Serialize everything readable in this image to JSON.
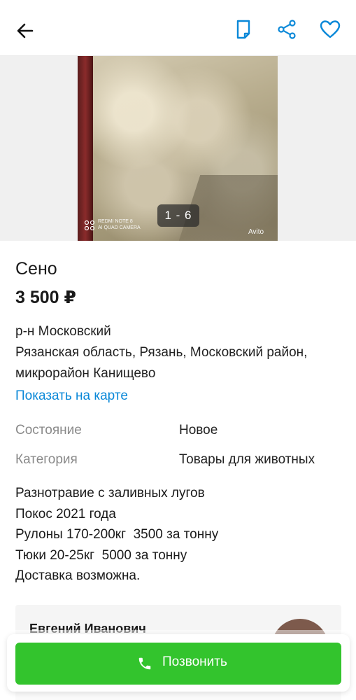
{
  "topbar": {
    "back_icon": "arrow-left-icon",
    "note_icon": "note-icon",
    "share_icon": "share-icon",
    "favorite_icon": "heart-icon",
    "accent_color": "#0a88d8"
  },
  "gallery": {
    "counter": "1 - 6",
    "watermark_line1": "REDMI NOTE 8",
    "watermark_line2": "AI QUAD CAMERA",
    "brand_watermark": "Avito"
  },
  "listing": {
    "title": "Сено",
    "price": "3 500 ₽",
    "address_line1": "р-н Московский",
    "address_line2": "Рязанская область, Рязань, Московский район,",
    "address_line3": "микрорайон Канищево",
    "map_link": "Показать на карте"
  },
  "properties": [
    {
      "label": "Состояние",
      "value": "Новое"
    },
    {
      "label": "Категория",
      "value": "Товары для животных"
    }
  ],
  "description": [
    "Разнотравие с заливных лугов",
    "Покос 2021 года",
    "Рулоны 170-200кг  3500 за тонну",
    "Тюки 20-25кг  5000 за тонну",
    "Доставка возможна."
  ],
  "seller": {
    "name": "Евгений Иванович"
  },
  "call": {
    "label": "Позвонить",
    "color": "#33c42d"
  }
}
